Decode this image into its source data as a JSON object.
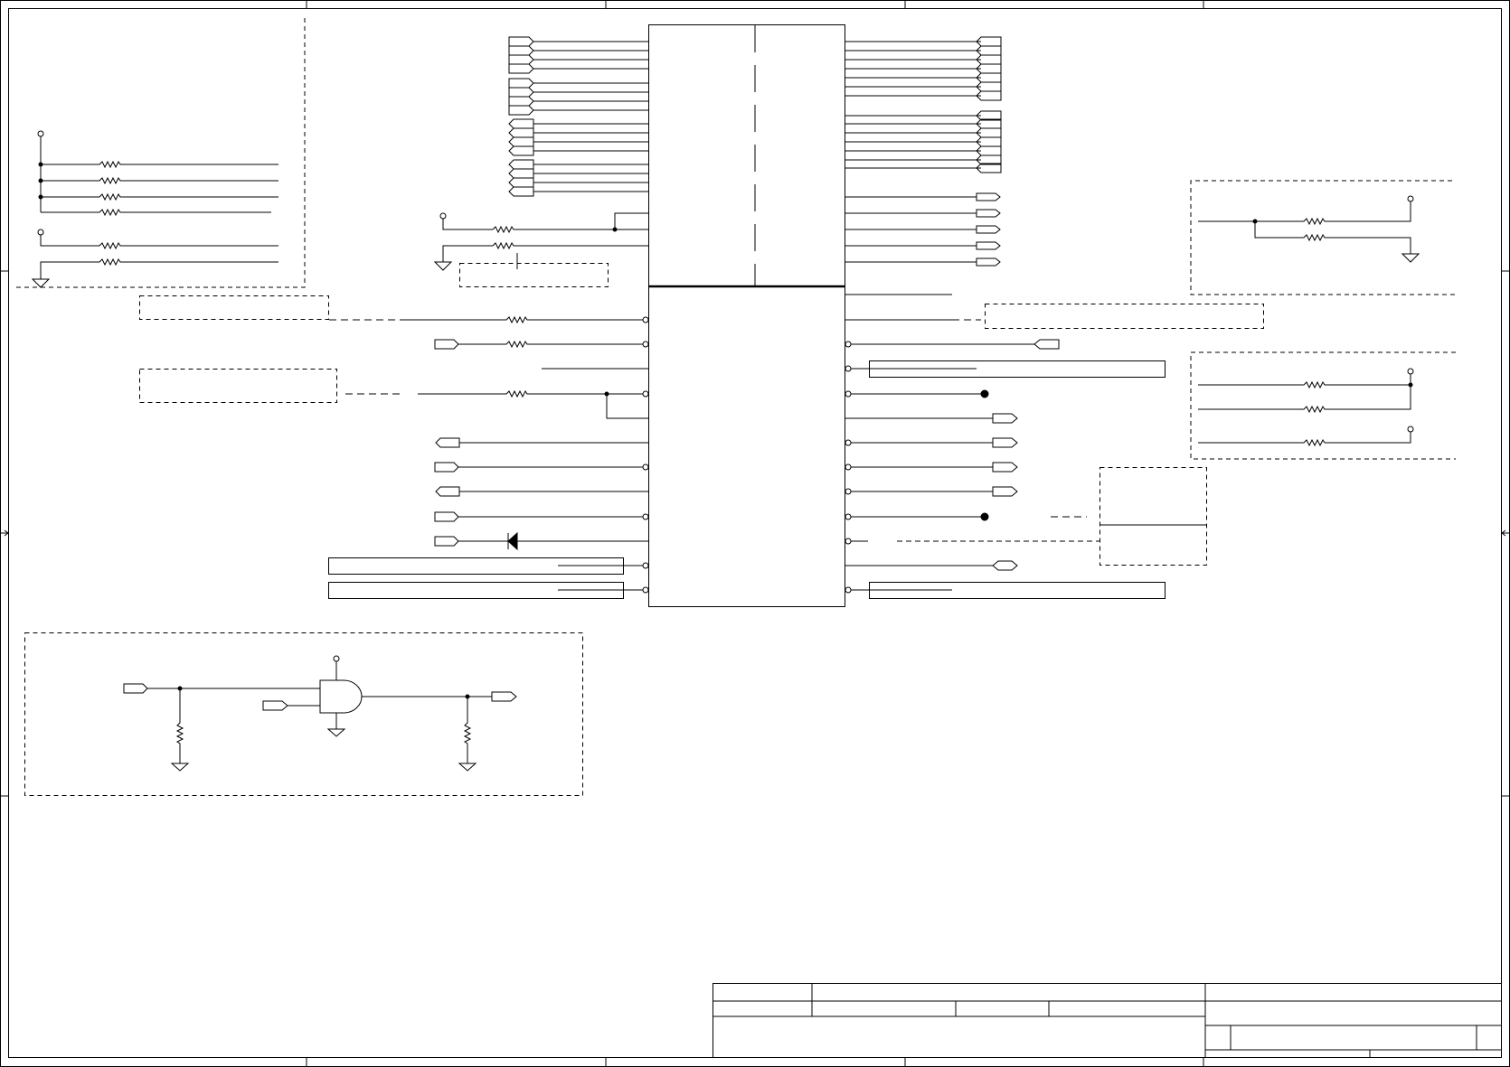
{
  "sheet": {
    "stroke_color": "#000000",
    "background": "#ffffff",
    "grid_columns": 5,
    "grid_rows": 4
  },
  "title_block": {
    "title": "",
    "rev": "",
    "date": "",
    "sheet": "",
    "size": ""
  },
  "ic": {
    "reference": "",
    "part_number": ""
  },
  "net_labels": [],
  "resistors_visible": 20,
  "icons": [
    "resistor-icon",
    "ground-icon",
    "power-pin-icon",
    "diode-icon",
    "and-gate-icon",
    "offpage-connector-icon",
    "bus-connector-icon",
    "test-point-icon"
  ]
}
